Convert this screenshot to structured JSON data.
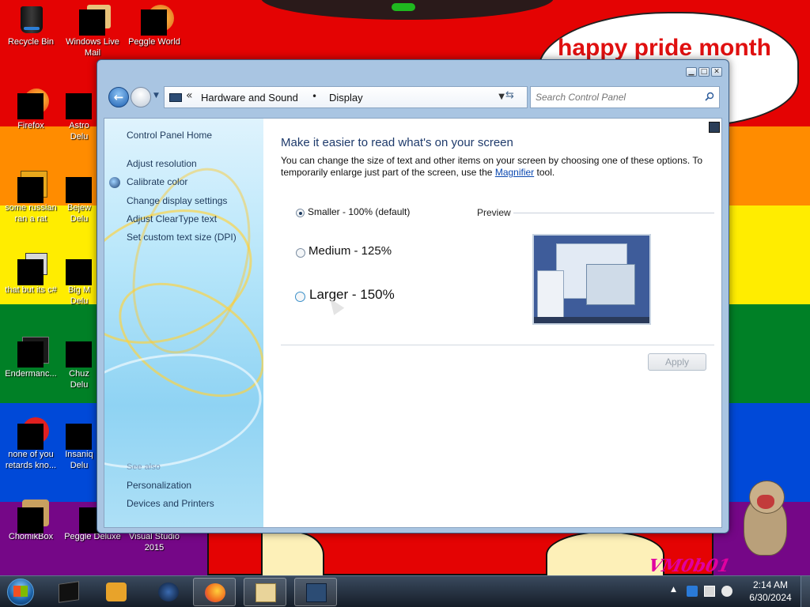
{
  "wallpaper": {
    "speech_text": "happy pride month",
    "watermark": "VM0b01",
    "colors": [
      "#e40303",
      "#ff8c00",
      "#ffed00",
      "#008026",
      "#0049d8",
      "#750787"
    ]
  },
  "desktop_icons": [
    {
      "name": "recycle-bin",
      "label": "Recycle Bin"
    },
    {
      "name": "windows-live-mail",
      "label": "Windows Live Mail"
    },
    {
      "name": "peggle-world",
      "label": "Peggle World"
    },
    {
      "name": "firefox",
      "label": "Firefox"
    },
    {
      "name": "astro-deluxe",
      "label": "Astro Delu"
    },
    {
      "name": "some-russian",
      "label": "some russian ran a rat"
    },
    {
      "name": "bejeweled-deluxe",
      "label": "Bejew Delu"
    },
    {
      "name": "that-but-its-csharp",
      "label": "that but its c#"
    },
    {
      "name": "big-money-deluxe",
      "label": "Big M Delu"
    },
    {
      "name": "endermanc",
      "label": "Endermanc..."
    },
    {
      "name": "chuzzle-deluxe",
      "label": "Chuz Delu"
    },
    {
      "name": "none-of-you",
      "label": "none of you retards kno..."
    },
    {
      "name": "insaniquarium-deluxe",
      "label": "Insaniq Delu"
    },
    {
      "name": "chomikbox",
      "label": "ChomikBox"
    },
    {
      "name": "peggle-deluxe",
      "label": "Peggle Deluxe"
    },
    {
      "name": "visual-studio",
      "label": "Visual Studio 2015"
    }
  ],
  "window": {
    "breadcrumb": [
      "Hardware and Sound",
      "Display"
    ],
    "search_placeholder": "Search Control Panel",
    "controls": {
      "minimize": "▁",
      "maximize": "□",
      "close": "✕"
    }
  },
  "left_pane": {
    "home_link": "Control Panel Home",
    "links": [
      "Adjust resolution",
      "Calibrate color",
      "Change display settings",
      "Adjust ClearType text",
      "Set custom text size (DPI)"
    ],
    "see_also_title": "See also",
    "see_also": [
      "Personalization",
      "Devices and Printers"
    ]
  },
  "main": {
    "heading": "Make it easier to read what's on your screen",
    "desc_1": "You can change the size of text and other items on your screen by choosing one of these options. To temporarily enlarge just part of the screen, use the",
    "desc_link": "Magnifier",
    "desc_2": "tool.",
    "options": [
      {
        "label": "Smaller - 100% (default)",
        "selected": true
      },
      {
        "label": "Medium - 125%",
        "selected": false
      },
      {
        "label": "Larger - 150%",
        "selected": false
      }
    ],
    "preview_label": "Preview",
    "apply_label": "Apply"
  },
  "taskbar": {
    "time": "2:14 AM",
    "date": "6/30/2024"
  }
}
